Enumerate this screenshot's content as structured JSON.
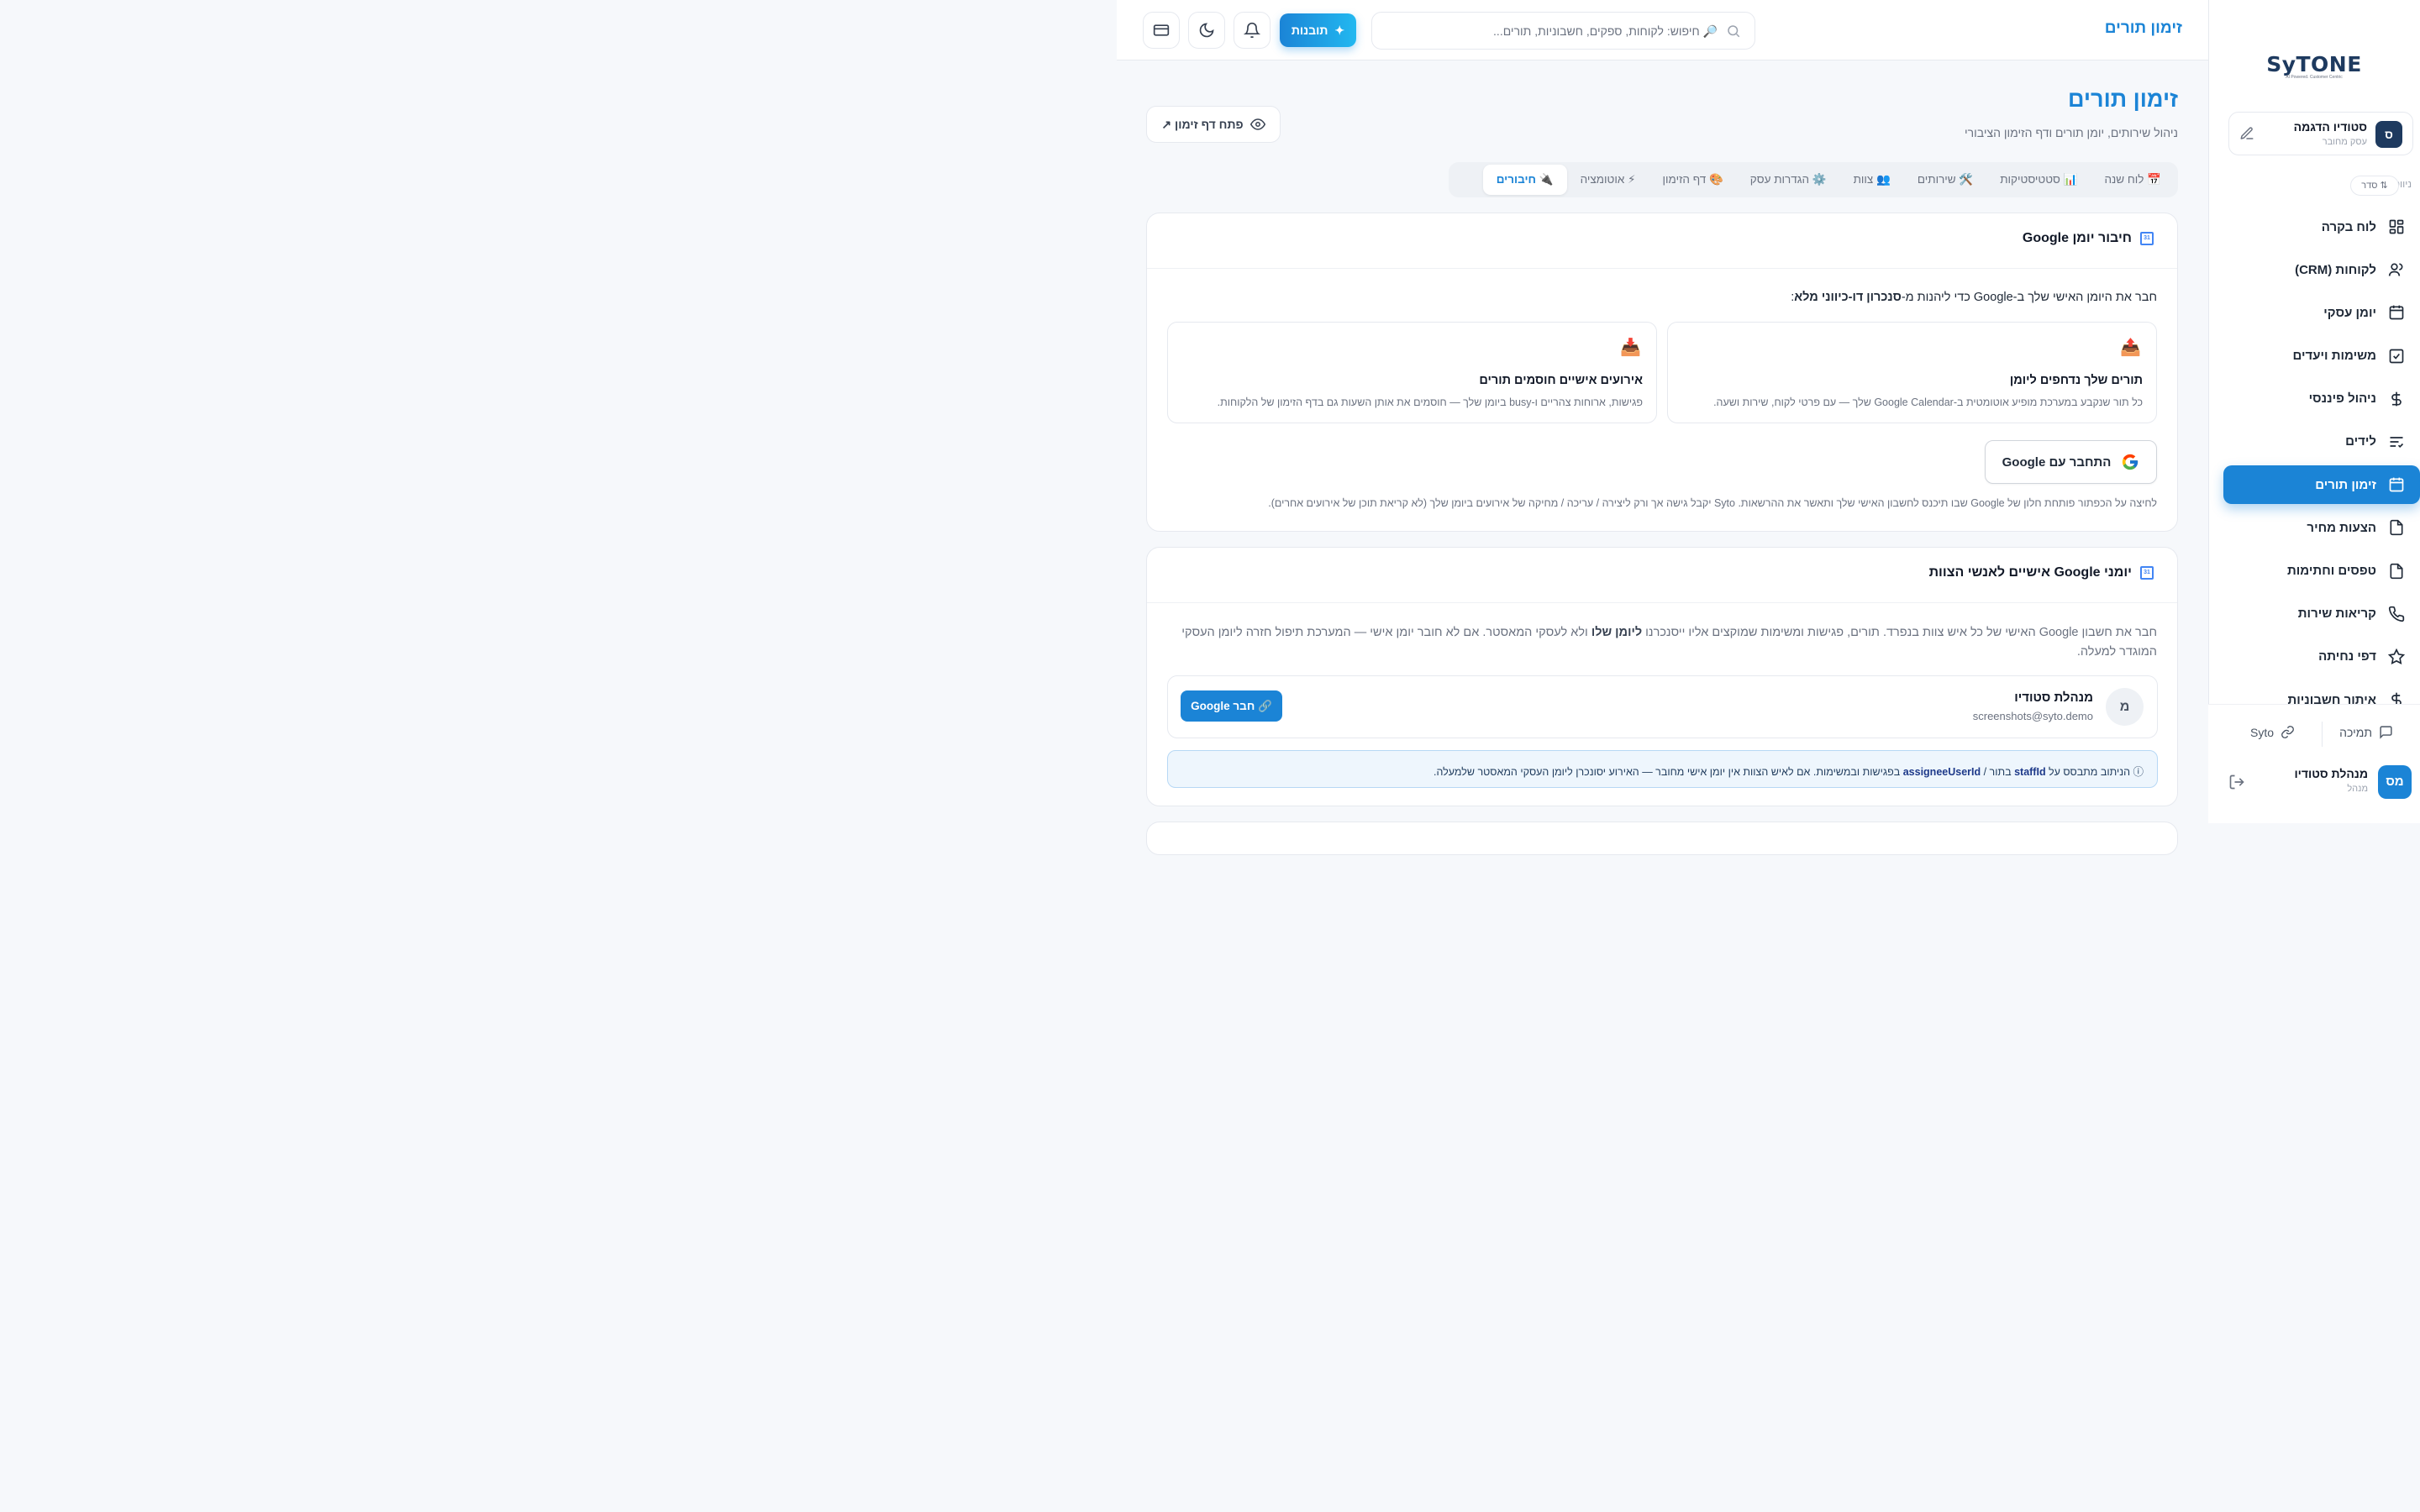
{
  "sidebar": {
    "logo": "SyTONE",
    "logo_tagline": "AI Powered. Customer Centric",
    "business": {
      "initial": "ס",
      "name": "סטודיו הדגמה",
      "subtitle": "עסק מחובר"
    },
    "nav_heading": "ניווט",
    "sort_label": "סדר",
    "items": [
      {
        "label": "לוח בקרה",
        "icon": "dashboard-icon"
      },
      {
        "label": "לקוחות (CRM)",
        "icon": "users-icon"
      },
      {
        "label": "יומן עסקי",
        "icon": "calendar-icon"
      },
      {
        "label": "משימות ויעדים",
        "icon": "check-square-icon"
      },
      {
        "label": "ניהול פיננסי",
        "icon": "dollar-icon"
      },
      {
        "label": "לידים",
        "icon": "list-icon"
      },
      {
        "label": "זימון תורים",
        "icon": "calendar-icon",
        "active": true
      },
      {
        "label": "הצעות מחיר",
        "icon": "file-icon"
      },
      {
        "label": "טפסים וחתימות",
        "icon": "file-icon"
      },
      {
        "label": "קריאות שירות",
        "icon": "phone-icon"
      },
      {
        "label": "דפי נחיתה",
        "icon": "star-icon"
      },
      {
        "label": "איתור חשבוניות",
        "icon": "dollar-icon"
      }
    ],
    "support_label": "תמיכה",
    "syto_label": "Syto",
    "user": {
      "initials": "מס",
      "name": "מנהלת סטודיו",
      "role": "מנהל"
    }
  },
  "topbar": {
    "title": "זימון תורים",
    "search_placeholder": "🔎 חיפוש: לקוחות, ספקים, חשבוניות, תורים...",
    "insights_label": "תובנות"
  },
  "page": {
    "title": "זימון תורים",
    "subtitle": "ניהול שירותים, יומן תורים ודף הזימון הציבורי",
    "open_page_label": "פתח דף זימון ↗"
  },
  "tabs": [
    {
      "label": "📅 לוח שנה"
    },
    {
      "label": "📊 סטטיסטיקות"
    },
    {
      "label": "🛠️ שירותים"
    },
    {
      "label": "👥 צוות"
    },
    {
      "label": "⚙️ הגדרות עסק"
    },
    {
      "label": "🎨 דף הזימון"
    },
    {
      "label": "⚡ אוטומציה"
    },
    {
      "label": "🔌 חיבורים",
      "active": true
    }
  ],
  "google_card": {
    "title": "חיבור יומן Google",
    "intro_prefix": "חבר את היומן האישי שלך ב-Google כדי ליהנות מ-",
    "intro_bold": "סנכרון דו-כיווני מלא",
    "intro_suffix": ":",
    "features": [
      {
        "icon": "📤",
        "title": "תורים שלך נדחפים ליומן",
        "desc": "כל תור שנקבע במערכת מופיע אוטומטית ב-Google Calendar שלך — עם פרטי לקוח, שירות ושעה."
      },
      {
        "icon": "📥",
        "title": "אירועים אישיים חוסמים תורים",
        "desc": "פגישות, ארוחות צהריים ו-busy ביומן שלך — חוסמים את אותן השעות גם בדף הזימון של הלקוחות."
      }
    ],
    "connect_label": "התחבר עם Google",
    "note": "לחיצה על הכפתור פותחת חלון של Google שבו תיכנס לחשבון האישי שלך ותאשר את ההרשאות. Syto יקבל גישה אך ורק ליצירה / עריכה / מחיקה של אירועים ביומן שלך (לא קריאת תוכן של אירועים אחרים)."
  },
  "team_card": {
    "title": "יומני Google אישיים לאנשי הצוות",
    "desc_prefix": "חבר את חשבון Google האישי של כל איש צוות בנפרד. תורים, פגישות ומשימות שמוקצים אליו ייסנכרנו ",
    "desc_bold": "ליומן שלו",
    "desc_suffix": " ולא לעסקי המאסטר. אם לא חובר יומן אישי — המערכת תיפול חזרה ליומן העסקי המוגדר למעלה.",
    "member": {
      "initial": "מ",
      "name": "מנהלת סטודיו",
      "email": "screenshots@syto.demo",
      "connect_label": "🔗 חבר Google"
    },
    "info_prefix": "ⓘ הניתוב מתבסס על ",
    "info_bold1": "staffId",
    "info_mid1": " בתור / ",
    "info_bold2": "assigneeUserId",
    "info_suffix": " בפגישות ובמשימות. אם לאיש הצוות אין יומן אישי מחובר — האירוע יסונכרן ליומן העסקי המאסטר שלמעלה."
  },
  "colors": {
    "primary": "#1b84d6",
    "navy": "#1e3a5f",
    "background": "#f6f8fb"
  }
}
